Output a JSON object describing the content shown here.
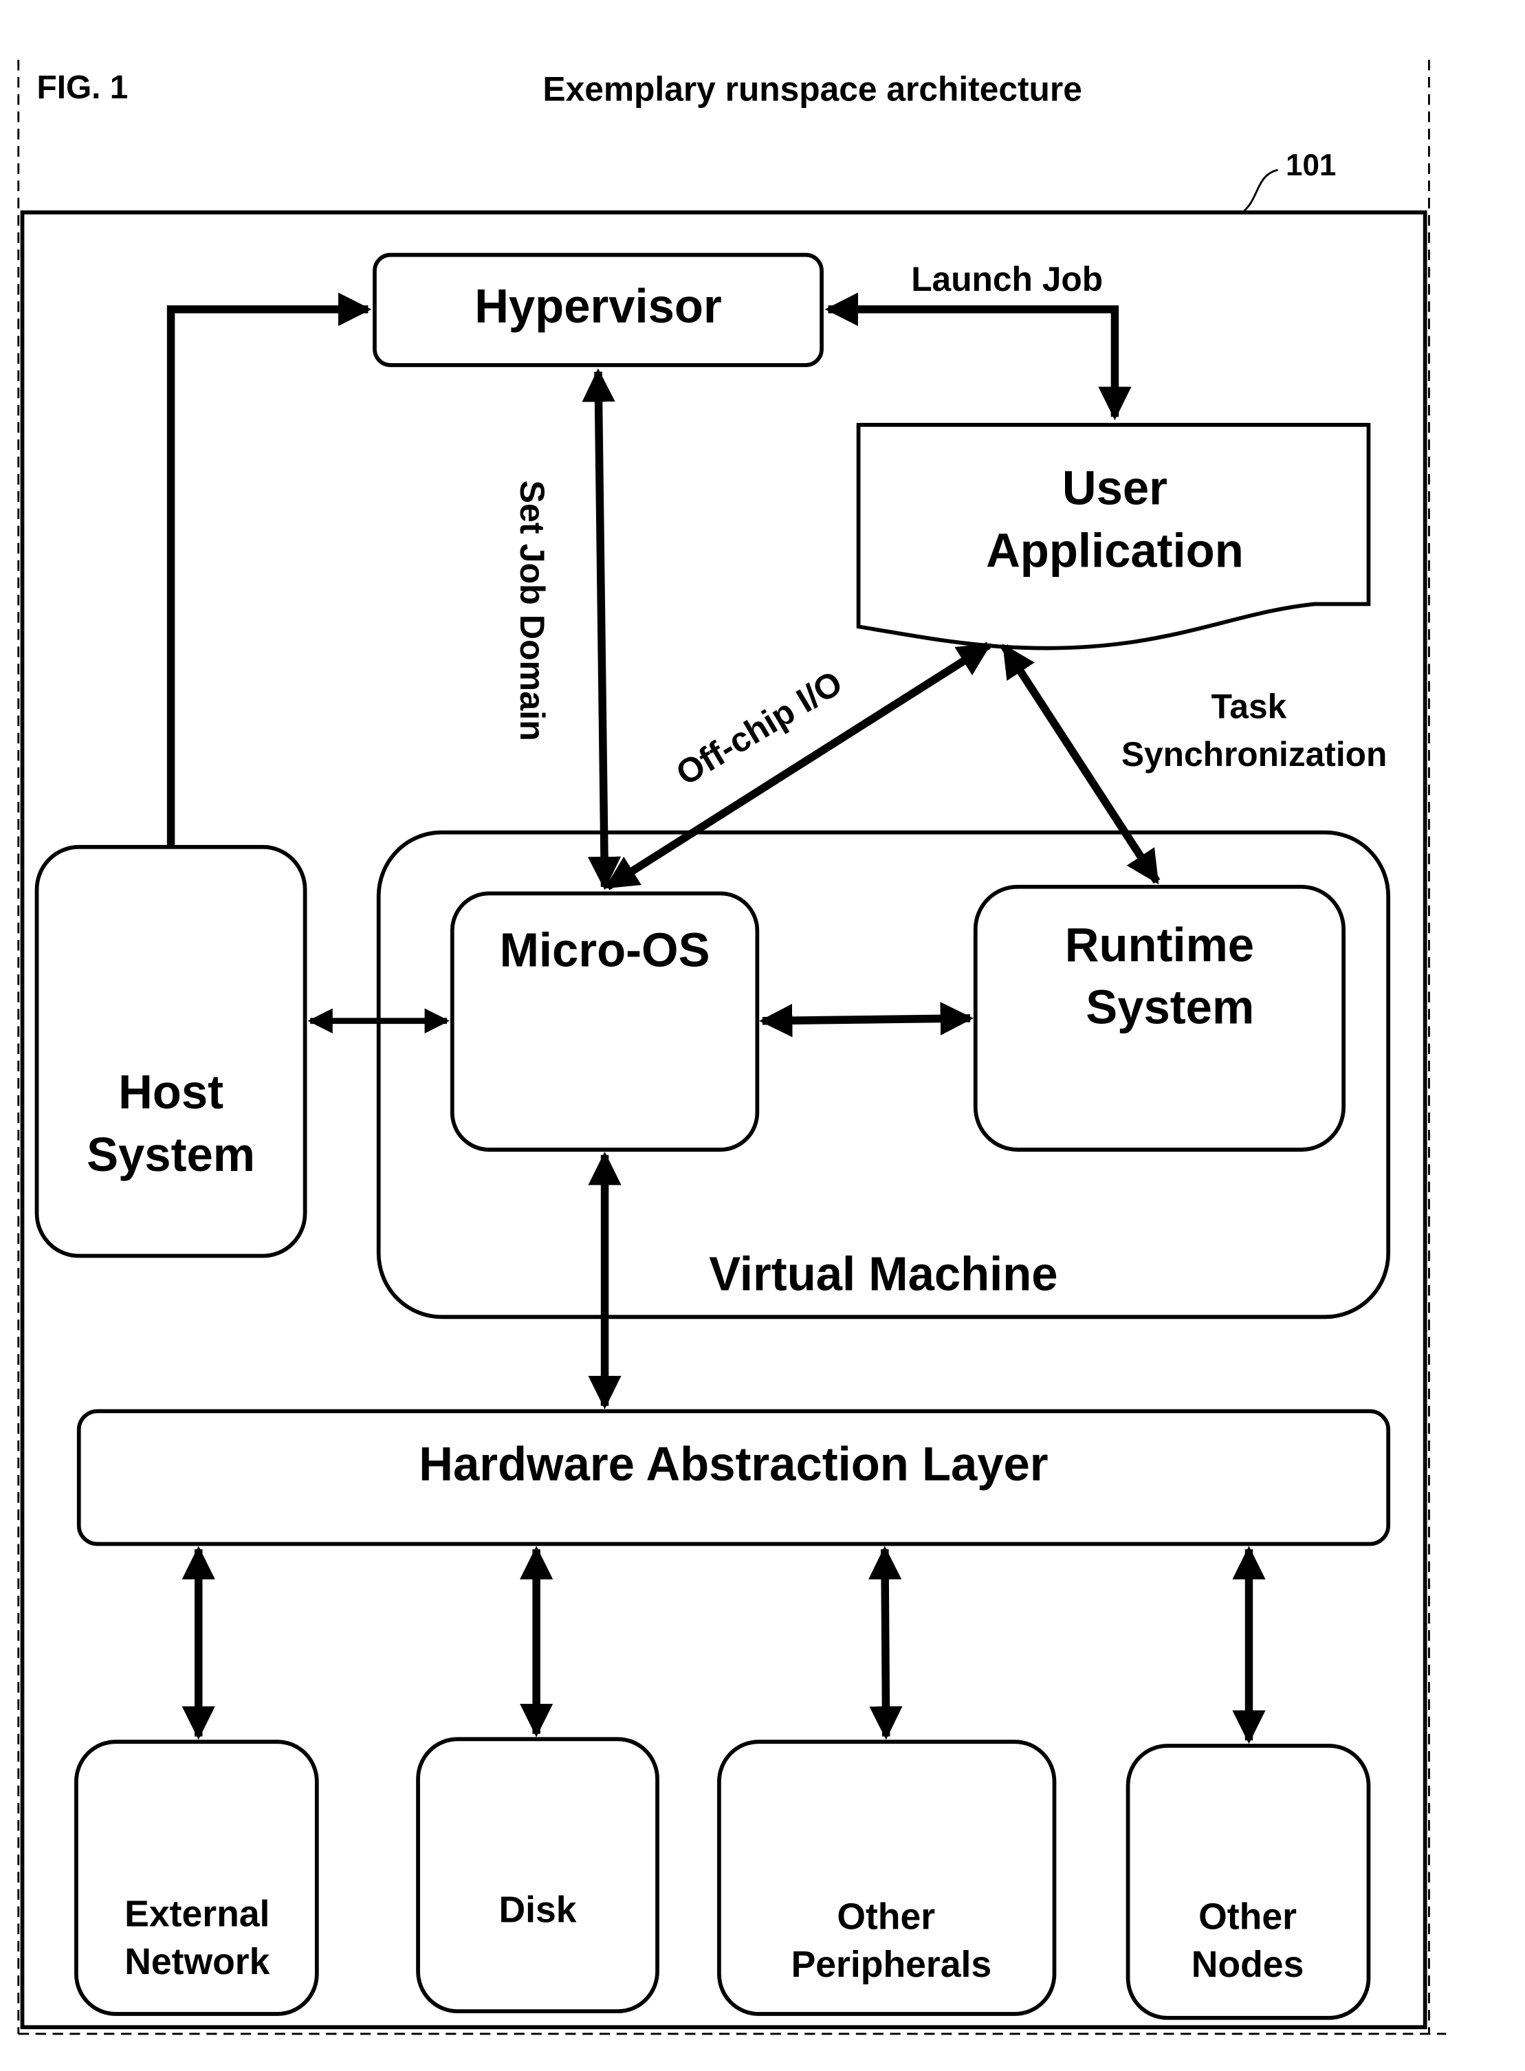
{
  "figure": {
    "label": "FIG. 1",
    "title": "Exemplary runspace architecture",
    "reference_number": "101"
  },
  "nodes": {
    "hypervisor": "Hypervisor",
    "user_application": [
      "User",
      "Application"
    ],
    "host_system": [
      "Host",
      "System"
    ],
    "micro_os": "Micro-OS",
    "runtime_system": [
      "Runtime",
      "System"
    ],
    "virtual_machine": "Virtual Machine",
    "hal": "Hardware Abstraction Layer",
    "external_network": [
      "External",
      "Network"
    ],
    "disk": "Disk",
    "other_peripherals": [
      "Other",
      "Peripherals"
    ],
    "other_nodes": [
      "Other",
      "Nodes"
    ]
  },
  "edge_labels": {
    "launch_job": "Launch Job",
    "set_job_domain": "Set Job Domain",
    "off_chip_io": "Off-chip I/O",
    "task_sync": [
      "Task",
      "Synchronization"
    ]
  },
  "colors": {
    "ink": "#000000",
    "paper": "#ffffff"
  }
}
